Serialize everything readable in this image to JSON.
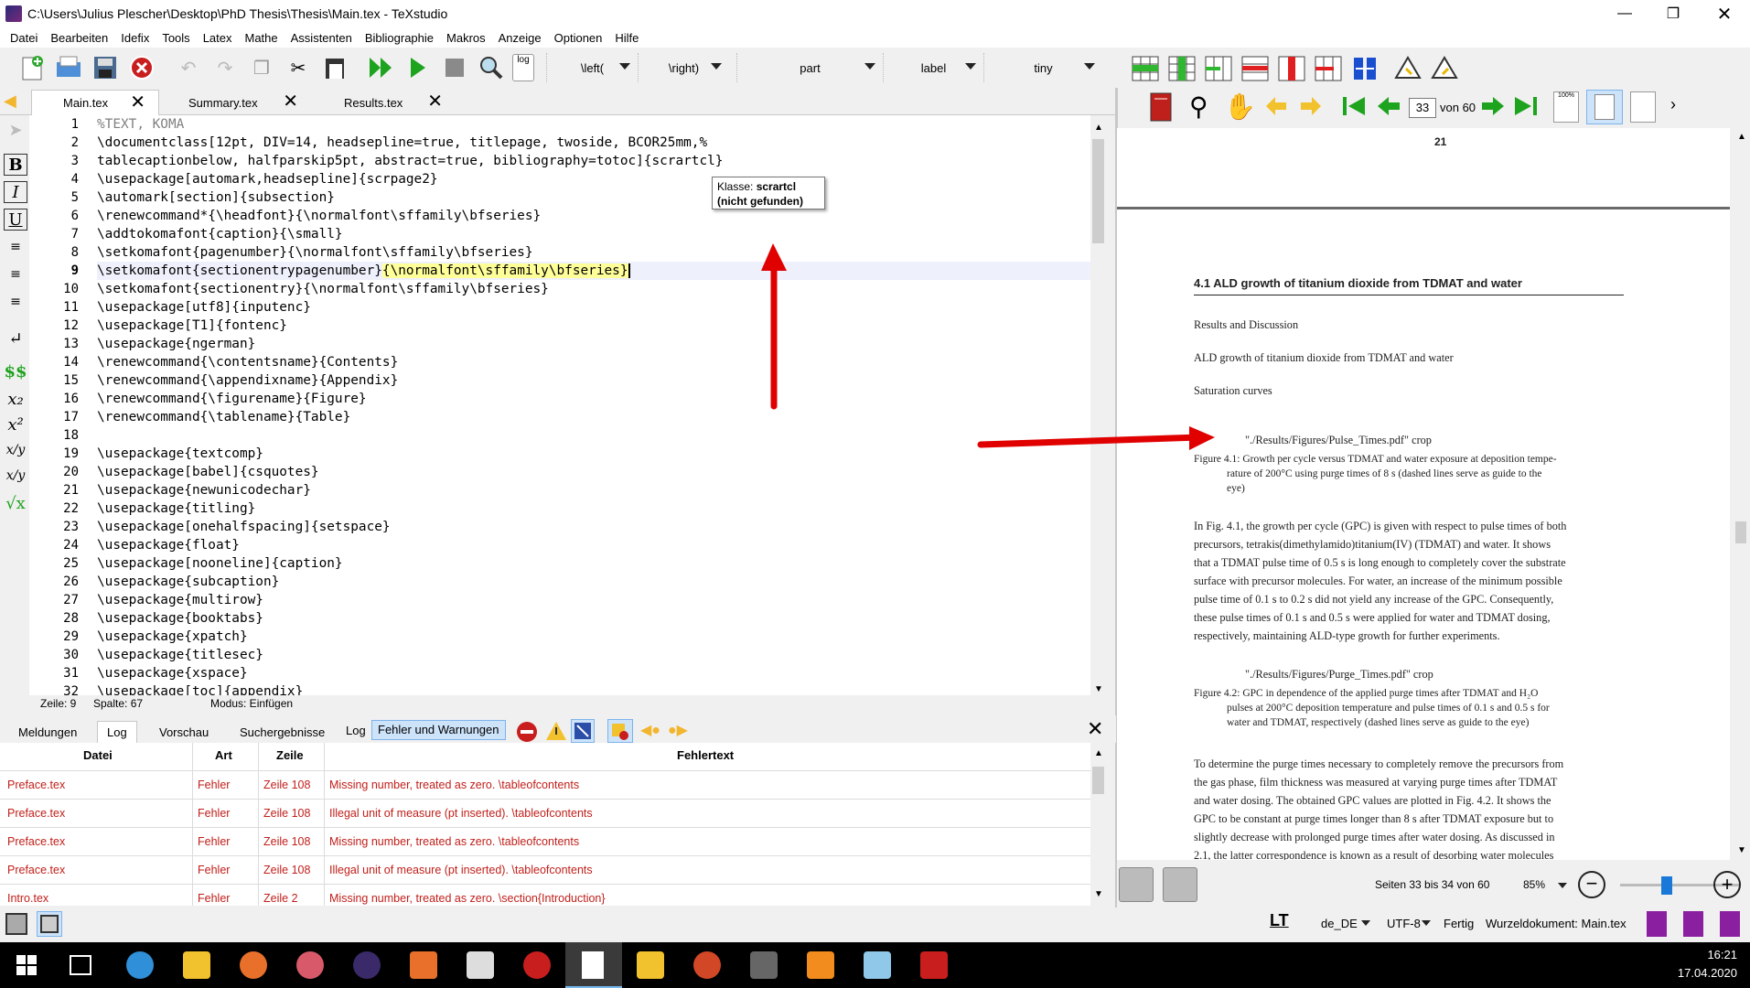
{
  "window": {
    "title": "C:\\Users\\Julius Plescher\\Desktop\\PhD Thesis\\Thesis\\Main.tex - TeXstudio"
  },
  "menu": [
    "Datei",
    "Bearbeiten",
    "Idefix",
    "Tools",
    "Latex",
    "Mathe",
    "Assistenten",
    "Bibliographie",
    "Makros",
    "Anzeige",
    "Optionen",
    "Hilfe"
  ],
  "toolbar": {
    "log_label": "log",
    "combos": [
      "\\left(",
      "\\right)",
      "part",
      "label",
      "tiny"
    ]
  },
  "tabs": [
    "Main.tex",
    "Summary.tex",
    "Results.tex"
  ],
  "editor": {
    "lines": [
      "%TEXT, KOMA",
      "\\documentclass[12pt, DIV=14, headsepline=true, titlepage, twoside, BCOR25mm,%",
      "tablecaptionbelow, halfparskip5pt, abstract=true, bibliography=totoc]{scrartcl}",
      "\\usepackage[automark,headsepline]{scrpage2}",
      "\\automark[section]{subsection}",
      "\\renewcommand*{\\headfont}{\\normalfont\\sffamily\\bfseries}",
      "\\addtokomafont{caption}{\\small}",
      "\\setkomafont{pagenumber}{\\normalfont\\sffamily\\bfseries}",
      "\\setkomafont{sectionentrypagenumber}{\\normalfont\\sffamily\\bfseries}",
      "\\setkomafont{sectionentry}{\\normalfont\\sffamily\\bfseries}",
      "\\usepackage[utf8]{inputenc}",
      "\\usepackage[T1]{fontenc}",
      "\\usepackage{ngerman}",
      "\\renewcommand{\\contentsname}{Contents}",
      "\\renewcommand{\\appendixname}{Appendix}",
      "\\renewcommand{\\figurename}{Figure}",
      "\\renewcommand{\\tablename}{Table}",
      "",
      "\\usepackage{textcomp}",
      "\\usepackage[babel]{csquotes}",
      "\\usepackage{newunicodechar}",
      "\\usepackage{titling}",
      "\\usepackage[onehalfspacing]{setspace}",
      "\\usepackage{float}",
      "\\usepackage[nooneline]{caption}",
      "\\usepackage{subcaption}",
      "\\usepackage{multirow}",
      "\\usepackage{booktabs}",
      "\\usepackage{xpatch}",
      "\\usepackage{titlesec}",
      "\\usepackage{xspace}",
      "\\usepackage[toc]{appendix}"
    ],
    "line9_part1": "\\setkomafont{sectionentrypagenumber}",
    "line9_part2": "{\\normalfont\\sffamily\\bfseries}"
  },
  "tooltip": {
    "prefix": "Klasse: ",
    "name": "scrartcl",
    "note": "(nicht gefunden)"
  },
  "editor_status": {
    "line": "Zeile: 9",
    "column": "Spalte: 67",
    "mode": "Modus: Einfügen"
  },
  "bottom_tabs": [
    "Meldungen",
    "Log",
    "Vorschau",
    "Suchergebnisse"
  ],
  "log_toggle": {
    "log": "Log",
    "errors": "Fehler und Warnungen"
  },
  "log_table": {
    "headers": [
      "Datei",
      "Art",
      "Zeile",
      "Fehlertext"
    ],
    "rows": [
      {
        "file": "Preface.tex",
        "type": "Fehler",
        "line": "Zeile 108",
        "text": "Missing number, treated as zero. \\tableofcontents"
      },
      {
        "file": "Preface.tex",
        "type": "Fehler",
        "line": "Zeile 108",
        "text": "Illegal unit of measure (pt inserted). \\tableofcontents"
      },
      {
        "file": "Preface.tex",
        "type": "Fehler",
        "line": "Zeile 108",
        "text": "Missing number, treated as zero. \\tableofcontents"
      },
      {
        "file": "Preface.tex",
        "type": "Fehler",
        "line": "Zeile 108",
        "text": "Illegal unit of measure (pt inserted). \\tableofcontents"
      },
      {
        "file": "Intro.tex",
        "type": "Fehler",
        "line": "Zeile 2",
        "text": "Missing number, treated as zero. \\section{Introduction}"
      }
    ]
  },
  "pdf": {
    "page_input": "33",
    "page_total": "von 60",
    "zoom_icon_label": "100%",
    "top_page_number": "21",
    "section_heading": "4.1  ALD growth of titanium dioxide from TDMAT and water",
    "texts": [
      "Results and Discussion",
      "ALD growth of titanium dioxide from TDMAT and water",
      "Saturation curves",
      "\"./Results/Figures/Pulse_Times.pdf\" crop",
      "Figure 4.1: Growth per cycle versus TDMAT and water exposure at deposition tempe-",
      "rature of 200°C using purge times of 8 s (dashed lines serve as guide to the",
      "eye)",
      "In Fig. 4.1, the growth per cycle (GPC) is given with respect to pulse times of both",
      "precursors, tetrakis(dimethylamido)titanium(IV) (TDMAT) and water. It shows",
      "that a TDMAT pulse time of 0.5 s is long enough to completely cover the substrate",
      "surface with precursor molecules. For water, an increase of the minimum possible",
      "pulse time of 0.1 s to 0.2 s did not yield any increase of the GPC. Consequently,",
      "these pulse times of 0.1 s and 0.5 s were applied for water and TDMAT dosing,",
      "respectively, maintaining ALD-type growth for further experiments.",
      "\"./Results/Figures/Purge_Times.pdf\" crop",
      "Figure 4.2: GPC in dependence of the applied purge times after TDMAT and H₂O",
      "pulses at 200°C deposition temperature and pulse times of 0.1 s and 0.5 s for",
      "water and TDMAT, respectively (dashed lines serve as guide to the eye)",
      "To determine the purge times necessary to completely remove the precursors from",
      "the gas phase, film thickness was measured at varying purge times after TDMAT",
      "and water dosing. The obtained GPC values are plotted in Fig. 4.2. It shows the",
      "GPC to be constant at purge times longer than 8 s after TDMAT exposure but to",
      "slightly decrease with prolonged purge times after water dosing. As discussed in",
      "2.1, the latter correspondence is known as a result of desorbing water molecules"
    ],
    "pages_label": "Seiten 33 bis 34 von 60",
    "zoom": "85%",
    "zoom_slider_value": 0.38
  },
  "statusbar": {
    "lt": "LT",
    "language": "de_DE",
    "encoding": "UTF-8",
    "state": "Fertig",
    "root": "Wurzeldokument: Main.tex"
  },
  "taskbar": {
    "time": "16:21",
    "date": "17.04.2020"
  },
  "colors": {
    "error_text": "#c0201b",
    "arrow": "#e00000",
    "current_line": "#eef0fb"
  }
}
